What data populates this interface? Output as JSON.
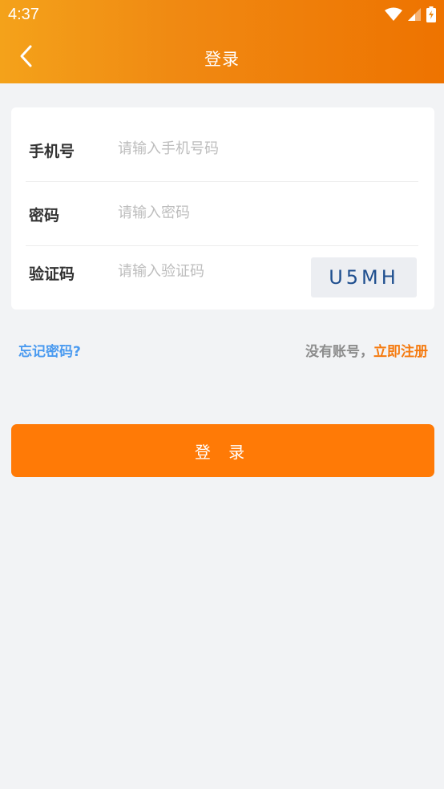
{
  "status_bar": {
    "time": "4:37"
  },
  "header": {
    "title": "登录"
  },
  "form": {
    "phone_label": "手机号",
    "phone_placeholder": "请输入手机号码",
    "password_label": "密码",
    "password_placeholder": "请输入密码",
    "captcha_label": "验证码",
    "captcha_placeholder": "请输入验证码",
    "captcha_code": "U5MH"
  },
  "links": {
    "forgot": "忘记密码?",
    "no_account": "没有账号，",
    "register": "立即注册"
  },
  "login_button": "登 录",
  "colors": {
    "header_start": "#f4a21a",
    "header_end": "#ee7300",
    "accent": "#ff7a06",
    "link_blue": "#4a9af0",
    "background": "#f2f3f5"
  }
}
